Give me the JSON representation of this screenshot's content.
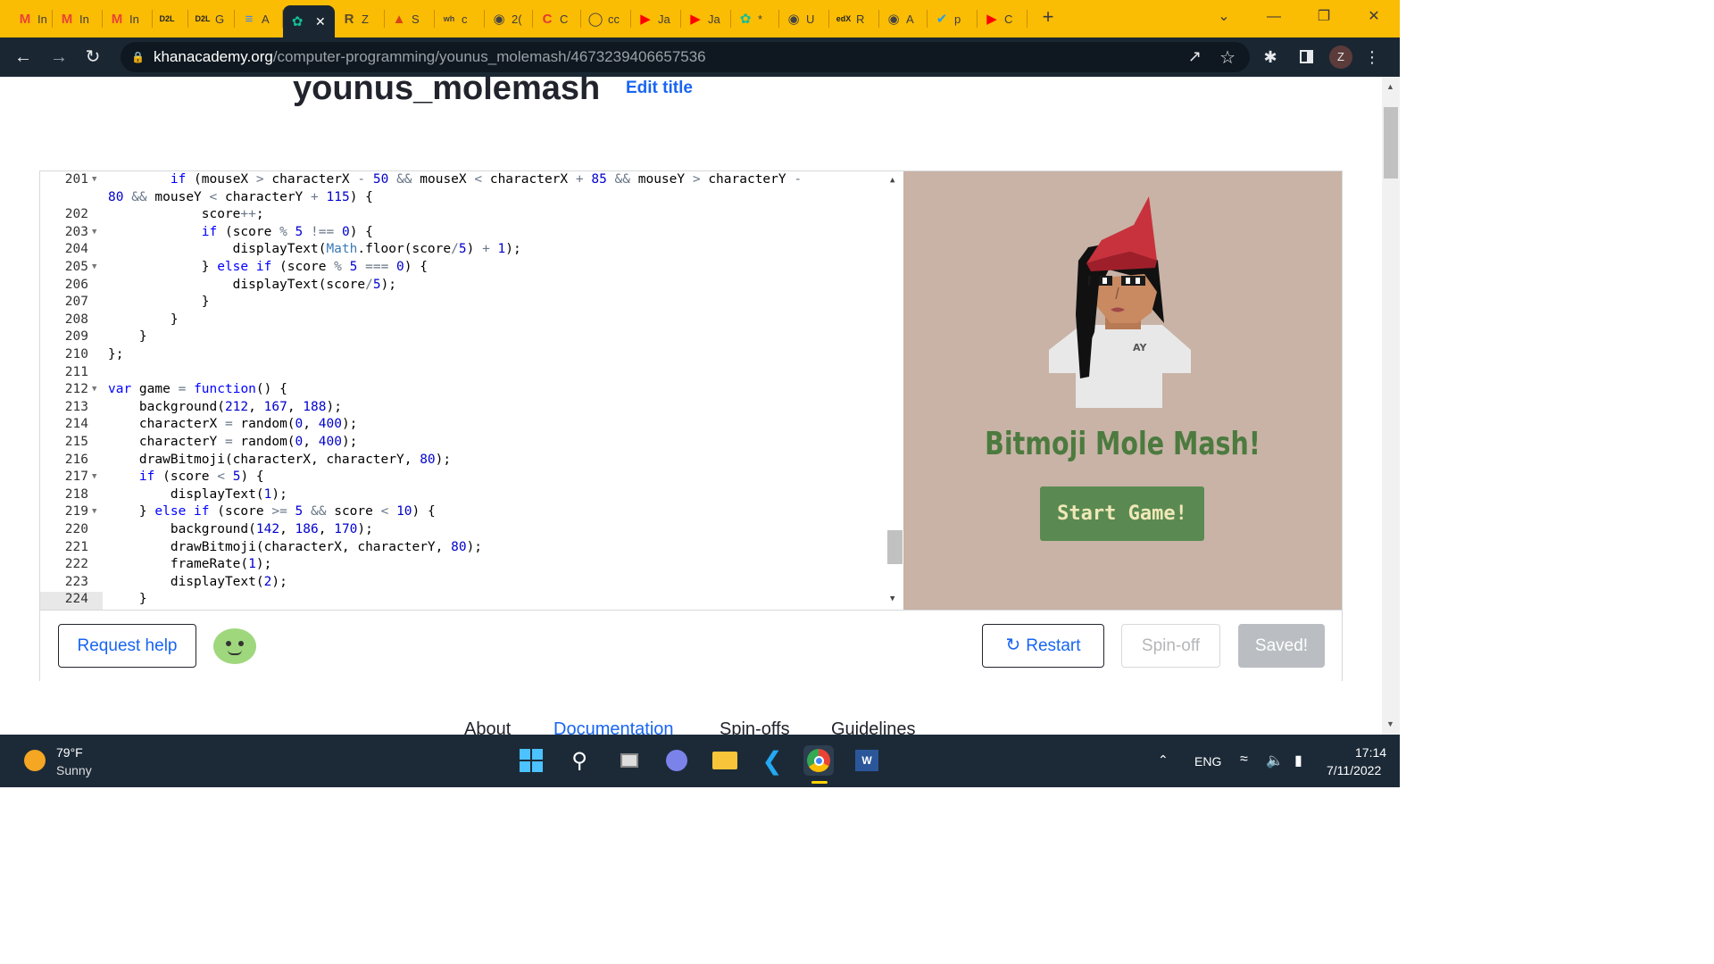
{
  "tabs": [
    {
      "icon": "gmail-icon",
      "label": "In",
      "color": "#ea4335",
      "glyph": "M"
    },
    {
      "icon": "gmail-icon",
      "label": "In",
      "color": "#ea4335",
      "glyph": "M"
    },
    {
      "icon": "gmail-icon",
      "label": "In",
      "color": "#ea4335",
      "glyph": "M"
    },
    {
      "icon": "d2l-icon",
      "label": "",
      "color": "#222222",
      "glyph": "D2L"
    },
    {
      "icon": "d2l-icon",
      "label": "G",
      "color": "#222222",
      "glyph": "D2L"
    },
    {
      "icon": "docs-icon",
      "label": "A",
      "color": "#4285f4",
      "glyph": "≡"
    },
    {
      "icon": "khan-icon",
      "label": "",
      "color": "#14bf96",
      "glyph": "✿",
      "active": true
    },
    {
      "icon": "r-icon",
      "label": "Z",
      "color": "#5a4a2a",
      "glyph": "R"
    },
    {
      "icon": "triangle-icon",
      "label": "S",
      "color": "#d84315",
      "glyph": "▲"
    },
    {
      "icon": "wh-icon",
      "label": "c",
      "color": "#ffffff",
      "glyph": "wh"
    },
    {
      "icon": "globe-icon",
      "label": "2(",
      "color": "#ffffff",
      "glyph": "◉"
    },
    {
      "icon": "c-icon",
      "label": "C",
      "color": "#e53935",
      "glyph": "C"
    },
    {
      "icon": "github-icon",
      "label": "cc",
      "color": "#ffffff",
      "glyph": "◯"
    },
    {
      "icon": "youtube-icon",
      "label": "Ja",
      "color": "#ff0000",
      "glyph": "▶"
    },
    {
      "icon": "youtube-icon",
      "label": "Ja",
      "color": "#ff0000",
      "glyph": "▶"
    },
    {
      "icon": "khan-icon",
      "label": "*",
      "color": "#14bf96",
      "glyph": "✿"
    },
    {
      "icon": "globe-icon",
      "label": "U",
      "color": "#ffffff",
      "glyph": "◉"
    },
    {
      "icon": "edx-icon",
      "label": "R",
      "color": "#222222",
      "glyph": "edX"
    },
    {
      "icon": "globe-icon",
      "label": "A",
      "color": "#ffffff",
      "glyph": "◉"
    },
    {
      "icon": "bird-icon",
      "label": "p",
      "color": "#1da1f2",
      "glyph": "✔"
    },
    {
      "icon": "youtube-icon",
      "label": "C",
      "color": "#ff0000",
      "glyph": "▶"
    }
  ],
  "new_tab": "+",
  "url": {
    "host": "khanacademy.org",
    "path": "/computer-programming/younus_molemash/4673239406657536"
  },
  "profile_initial": "Z",
  "page": {
    "title": "younus_molemash",
    "edit_title": "Edit title"
  },
  "code_lines": [
    {
      "n": "201",
      "fold": true,
      "html": "        <span class='kw'>if</span> (mouseX <span class='op'>&gt;</span> characterX <span class='op'>-</span> <span class='num'>50</span> <span class='op'>&amp;&amp;</span> mouseX <span class='op'>&lt;</span> characterX <span class='op'>+</span> <span class='num'>85</span> <span class='op'>&amp;&amp;</span> mouseY <span class='op'>&gt;</span> characterY <span class='op'>-</span>"
    },
    {
      "n": "",
      "fold": false,
      "html": "<span class='num'>80</span> <span class='op'>&amp;&amp;</span> mouseY <span class='op'>&lt;</span> characterY <span class='op'>+</span> <span class='num'>115</span>) {"
    },
    {
      "n": "202",
      "fold": false,
      "html": "            score<span class='op'>++</span>;"
    },
    {
      "n": "203",
      "fold": true,
      "html": "            <span class='kw'>if</span> (score <span class='op'>%</span> <span class='num'>5</span> <span class='op'>!==</span> <span class='num'>0</span>) {"
    },
    {
      "n": "204",
      "fold": false,
      "html": "                displayText(<span class='lib'>Math</span>.floor(score<span class='op'>/</span><span class='num'>5</span>) <span class='op'>+</span> <span class='num'>1</span>);"
    },
    {
      "n": "205",
      "fold": true,
      "html": "            } <span class='kw'>else if</span> (score <span class='op'>%</span> <span class='num'>5</span> <span class='op'>===</span> <span class='num'>0</span>) {"
    },
    {
      "n": "206",
      "fold": false,
      "html": "                displayText(score<span class='op'>/</span><span class='num'>5</span>);"
    },
    {
      "n": "207",
      "fold": false,
      "html": "            }"
    },
    {
      "n": "208",
      "fold": false,
      "html": "        }"
    },
    {
      "n": "209",
      "fold": false,
      "html": "    }"
    },
    {
      "n": "210",
      "fold": false,
      "html": "};"
    },
    {
      "n": "211",
      "fold": false,
      "html": ""
    },
    {
      "n": "212",
      "fold": true,
      "html": "<span class='kw'>var</span> game <span class='op'>=</span> <span class='kw'>function</span>() {"
    },
    {
      "n": "213",
      "fold": false,
      "html": "    background(<span class='num'>212</span>, <span class='num'>167</span>, <span class='num'>188</span>);"
    },
    {
      "n": "214",
      "fold": false,
      "html": "    characterX <span class='op'>=</span> random(<span class='num'>0</span>, <span class='num'>400</span>);"
    },
    {
      "n": "215",
      "fold": false,
      "html": "    characterY <span class='op'>=</span> random(<span class='num'>0</span>, <span class='num'>400</span>);"
    },
    {
      "n": "216",
      "fold": false,
      "html": "    drawBitmoji(characterX, characterY, <span class='num'>80</span>);"
    },
    {
      "n": "217",
      "fold": true,
      "html": "    <span class='kw'>if</span> (score <span class='op'>&lt;</span> <span class='num'>5</span>) {"
    },
    {
      "n": "218",
      "fold": false,
      "html": "        displayText(<span class='num'>1</span>);"
    },
    {
      "n": "219",
      "fold": true,
      "html": "    } <span class='kw'>else if</span> (score <span class='op'>&gt;=</span> <span class='num'>5</span> <span class='op'>&amp;&amp;</span> score <span class='op'>&lt;</span> <span class='num'>10</span>) {"
    },
    {
      "n": "220",
      "fold": false,
      "html": "        background(<span class='num'>142</span>, <span class='num'>186</span>, <span class='num'>170</span>);"
    },
    {
      "n": "221",
      "fold": false,
      "html": "        drawBitmoji(characterX, characterY, <span class='num'>80</span>);"
    },
    {
      "n": "222",
      "fold": false,
      "html": "        frameRate(<span class='num'>1</span>);"
    },
    {
      "n": "223",
      "fold": false,
      "html": "        displayText(<span class='num'>2</span>);"
    },
    {
      "n": "224",
      "fold": false,
      "html": "    }"
    }
  ],
  "canvas": {
    "title": "Bitmoji Mole Mash!",
    "start_button": "Start Game!",
    "shirt_text": "AY"
  },
  "buttons": {
    "request_help": "Request help",
    "restart": "Restart",
    "spin_off": "Spin-off",
    "saved": "Saved!"
  },
  "footer": {
    "about": "About",
    "documentation": "Documentation",
    "spinoffs": "Spin-offs",
    "guidelines": "Guidelines"
  },
  "weather": {
    "temp": "79°F",
    "condition": "Sunny"
  },
  "tray": {
    "lang": "ENG",
    "time": "17:14",
    "date": "7/11/2022"
  },
  "colors": {
    "accent": "#1865f2",
    "tabbar": "#fbbc04",
    "canvas_bg": "#c8b3a6",
    "title_green": "#4c7a3f",
    "button_green": "#5a8a52"
  }
}
